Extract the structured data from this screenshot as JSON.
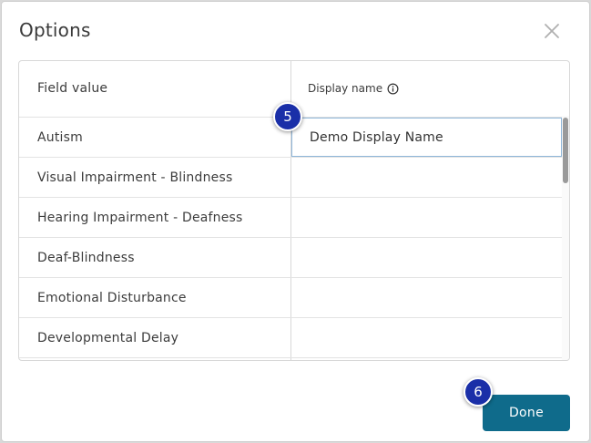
{
  "dialog": {
    "title": "Options",
    "close_icon": "close-icon"
  },
  "table": {
    "header": {
      "field_value": "Field value",
      "display_name": "Display name",
      "info_icon": "info-icon"
    },
    "rows": [
      {
        "field_value": "Autism",
        "display_name": "Demo Display Name"
      },
      {
        "field_value": "Visual Impairment - Blindness",
        "display_name": ""
      },
      {
        "field_value": "Hearing Impairment - Deafness",
        "display_name": ""
      },
      {
        "field_value": "Deaf-Blindness",
        "display_name": ""
      },
      {
        "field_value": "Emotional Disturbance",
        "display_name": ""
      },
      {
        "field_value": "Developmental Delay",
        "display_name": ""
      }
    ]
  },
  "badges": {
    "step_5": "5",
    "step_6": "6"
  },
  "footer": {
    "done_label": "Done"
  },
  "colors": {
    "done_button": "#0f6b8b",
    "badge": "#1a2fa8",
    "input_focus_border": "#8fb6d9"
  }
}
